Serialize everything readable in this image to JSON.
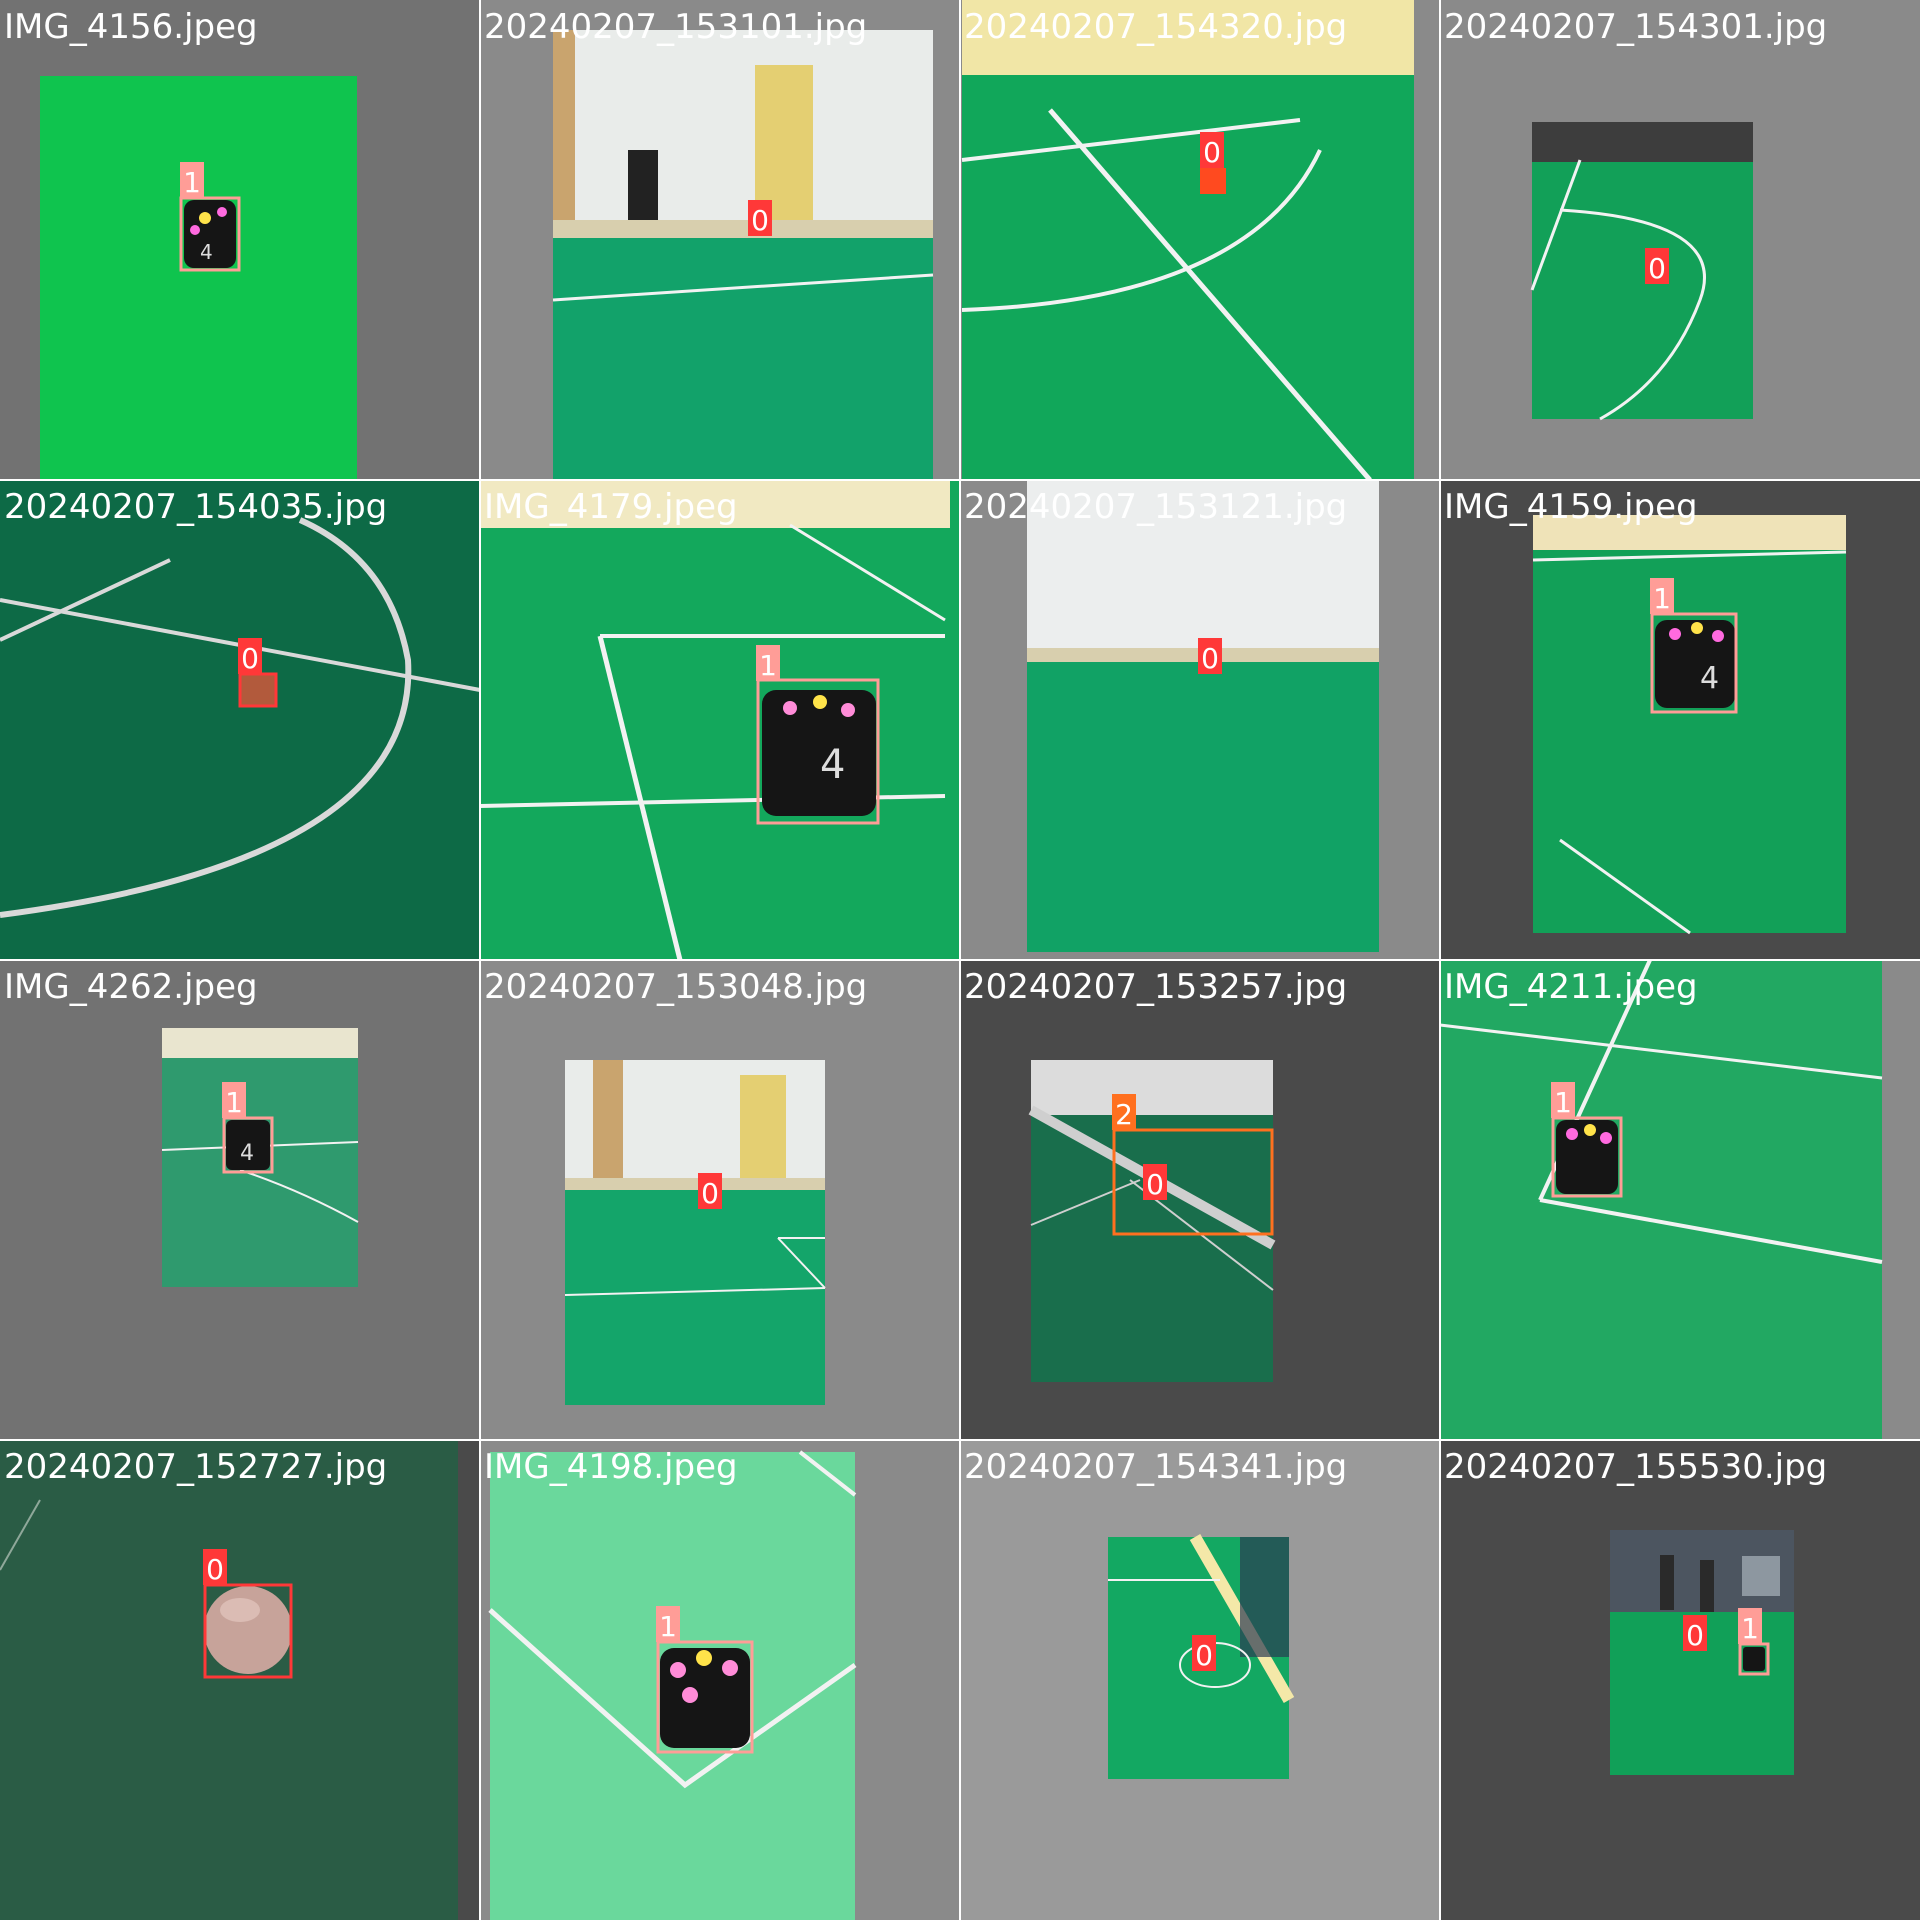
{
  "grid": {
    "tiles": [
      {
        "filename": "IMG_4156.jpeg",
        "labels": [
          "1"
        ]
      },
      {
        "filename": "20240207_153101.jpg",
        "labels": [
          "0"
        ]
      },
      {
        "filename": "20240207_154320.jpg",
        "labels": [
          "0"
        ]
      },
      {
        "filename": "20240207_154301.jpg",
        "labels": [
          "0"
        ]
      },
      {
        "filename": "20240207_154035.jpg",
        "labels": [
          "0"
        ]
      },
      {
        "filename": "IMG_4179.jpeg",
        "labels": [
          "1"
        ]
      },
      {
        "filename": "20240207_153121.jpg",
        "labels": [
          "0"
        ]
      },
      {
        "filename": "IMG_4159.jpeg",
        "labels": [
          "1"
        ]
      },
      {
        "filename": "IMG_4262.jpeg",
        "labels": [
          "1"
        ]
      },
      {
        "filename": "20240207_153048.jpg",
        "labels": [
          "0"
        ]
      },
      {
        "filename": "20240207_153257.jpg",
        "labels": [
          "2",
          "0"
        ]
      },
      {
        "filename": "IMG_4211.jpeg",
        "labels": [
          "1"
        ]
      },
      {
        "filename": "20240207_152727.jpg",
        "labels": [
          "0"
        ]
      },
      {
        "filename": "IMG_4198.jpeg",
        "labels": [
          "1"
        ]
      },
      {
        "filename": "20240207_154341.jpg",
        "labels": [
          "0"
        ]
      },
      {
        "filename": "20240207_155530.jpg",
        "labels": [
          "0",
          "1"
        ]
      }
    ]
  },
  "colors": {
    "class_0": "#ff3838",
    "class_1": "#ff9d97",
    "class_2": "#ff701f",
    "field_green": "#0f9a55",
    "line_white": "#f2f2f2",
    "letterbox_gray": "#727272",
    "dark_gray": "#4a4a4a",
    "robot_black": "#151515"
  },
  "icons": {
    "robot": "robot-marker-icon",
    "ball": "ball-icon"
  }
}
